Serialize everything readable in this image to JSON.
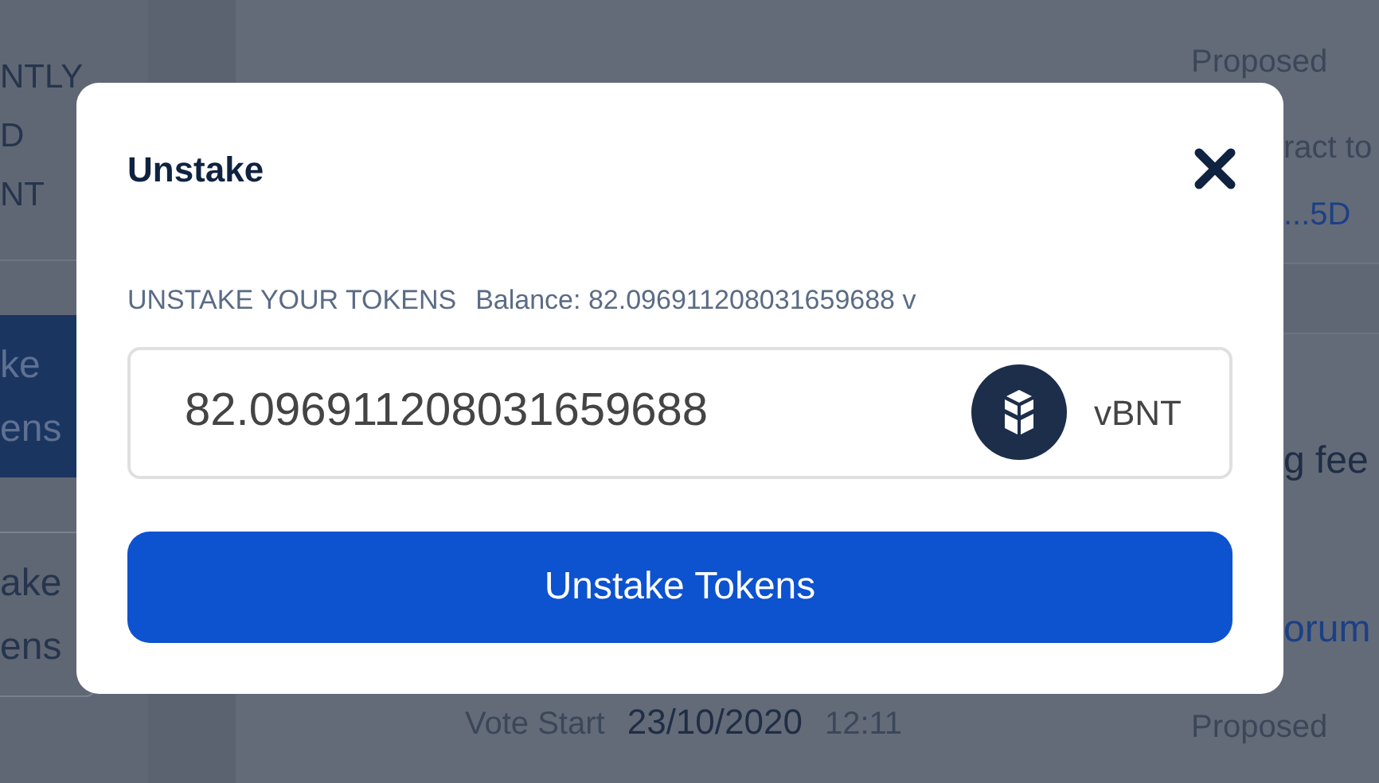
{
  "background": {
    "sidebar": {
      "texts": [
        "NTLY",
        "D",
        "NT"
      ],
      "buttons": [
        {
          "lines": [
            "ke",
            "ens"
          ],
          "selected": true
        },
        {
          "lines": [
            "ake",
            "ens"
          ],
          "selected": false
        }
      ]
    },
    "proposals": [
      {
        "proposed_label": "Proposed",
        "contract_text": "ract to",
        "contract_link": "...5D"
      },
      {
        "title": "g fee",
        "link": "orum",
        "vote_start_label": "Vote Start",
        "date": "23/10/2020",
        "time": "12:11",
        "proposed_label": "Proposed"
      }
    ]
  },
  "modal": {
    "title": "Unstake",
    "label": "UNSTAKE YOUR TOKENS",
    "balance": "Balance: 82.096911208031659688 v",
    "amount": "82.096911208031659688",
    "token": "vBNT",
    "button": "Unstake Tokens"
  }
}
